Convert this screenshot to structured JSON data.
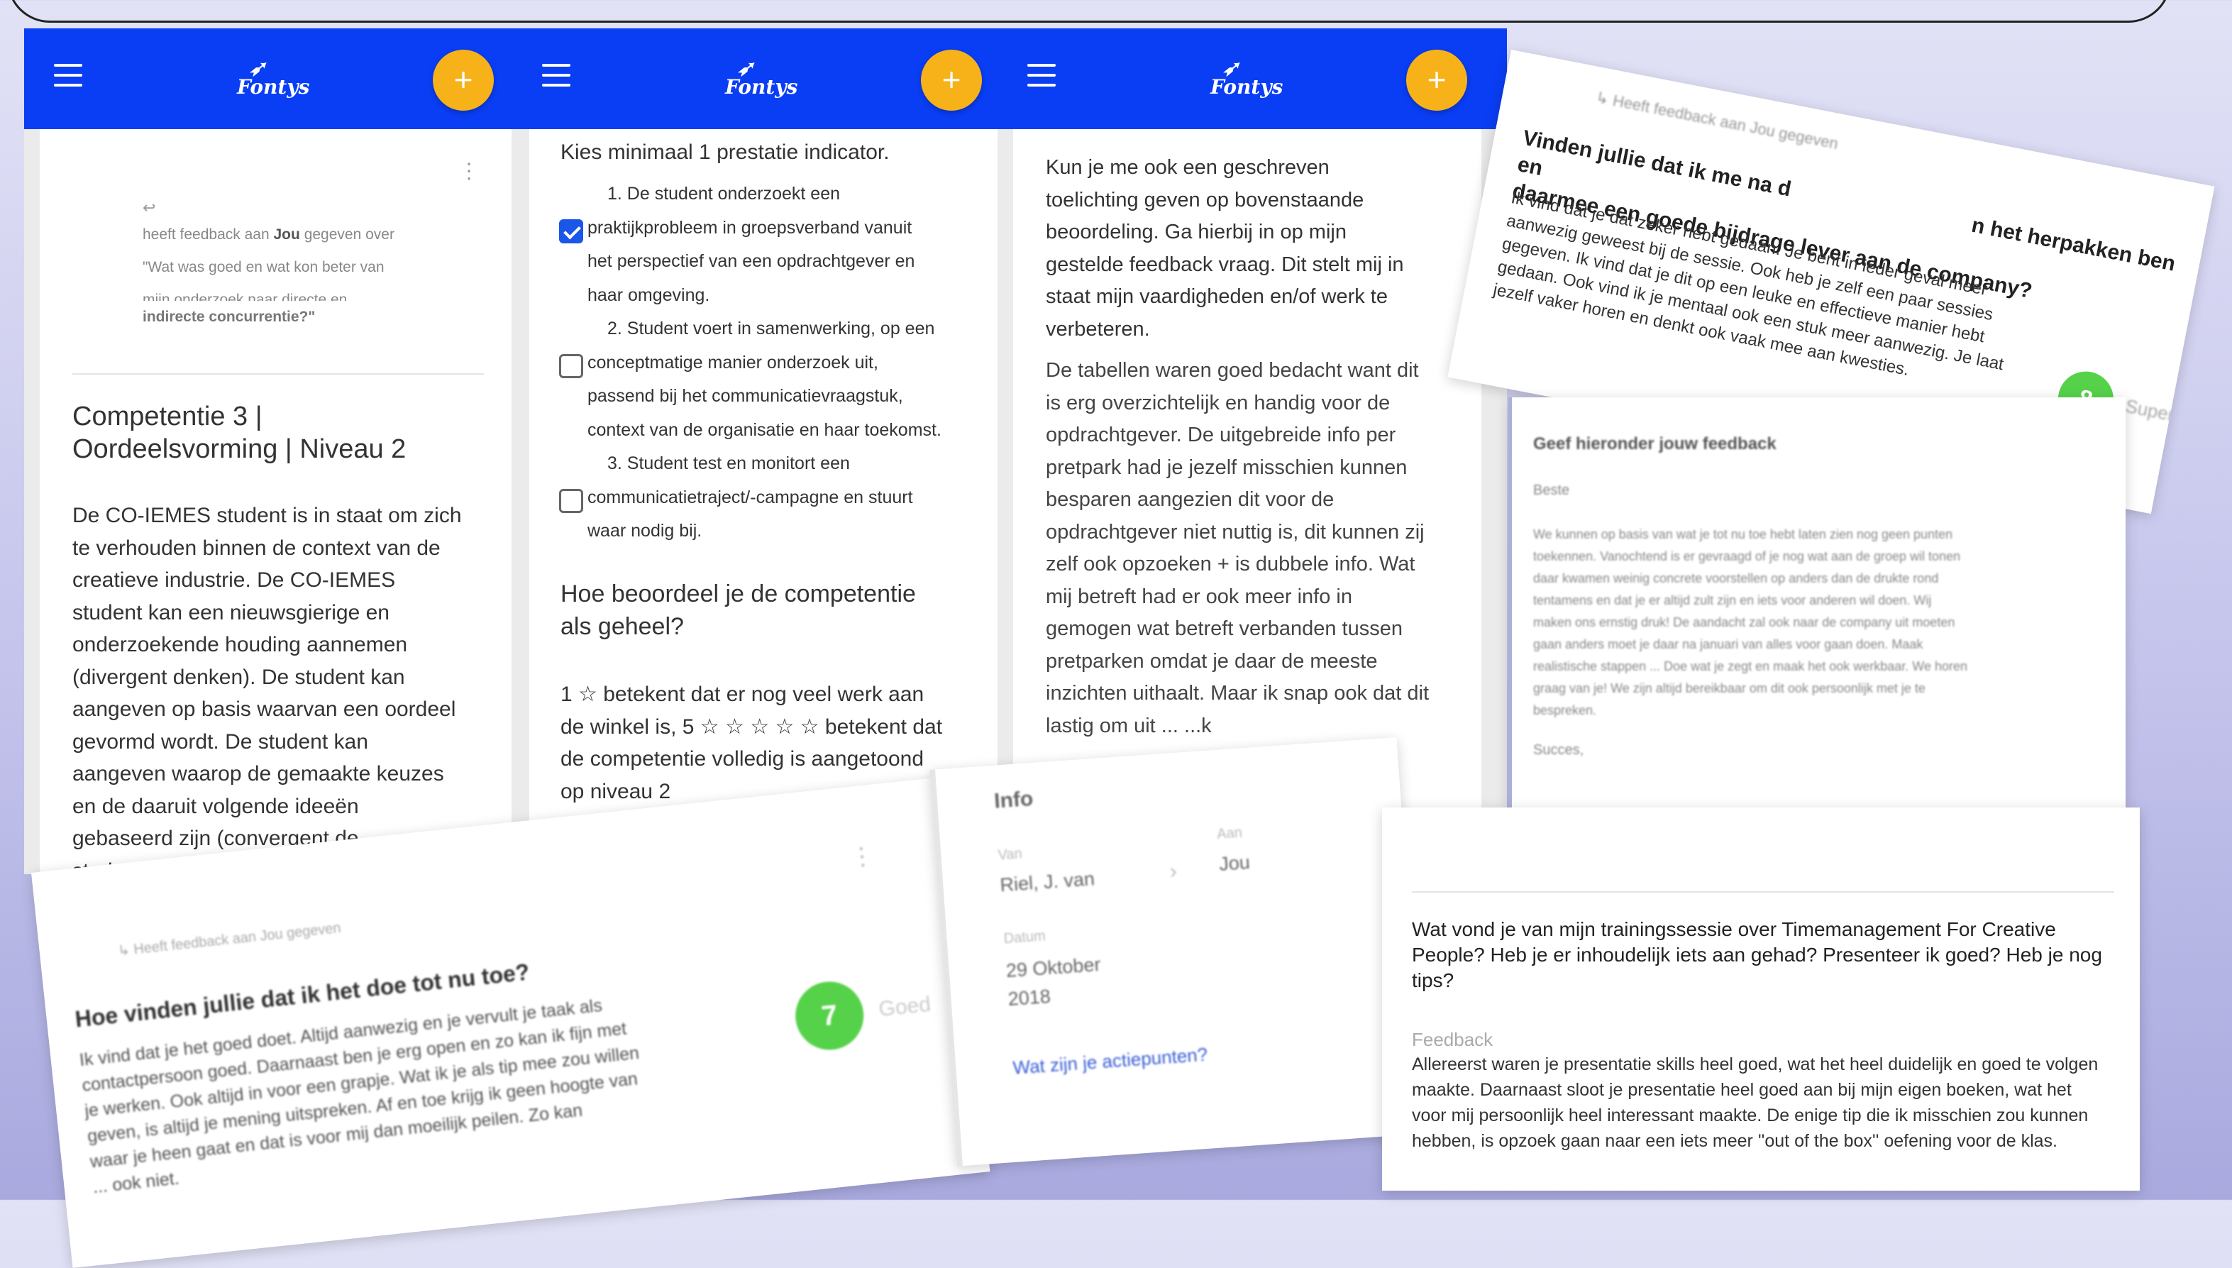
{
  "header": {
    "brand": "Fontys",
    "brand_icon": "bird-logo-icon",
    "fab_label": "+",
    "color": "#0a3ef5",
    "fab_color": "#f7b21a"
  },
  "col1": {
    "feedback_line1": "heeft feedback aan",
    "feedback_you": "Jou",
    "feedback_line1b": "gegeven over",
    "feedback_quote1": "\"Wat was goed en wat kon beter van",
    "feedback_quote2": "mijn onderzoek naar directe en",
    "feedback_quote3": "indirecte concurrentie?\"",
    "heading": "Competentie 3 | Oordeelsvorming | Niveau 2",
    "paragraph": [
      "De CO-IEMES student is in staat om zich",
      "te verhouden binnen de context van de",
      "creatieve industrie. De CO-IEMES",
      "student kan een nieuwsgierige en",
      "onderzoekende houding aannemen",
      "(divergent denken). De student kan",
      "aangeven op basis waarvan een oordeel",
      "gevormd wordt. De student kan",
      "aangeven waarop de gemaakte keuzes",
      "en de daaruit volgende ideeën",
      "gebaseerd zijn (convergent de...",
      "student..."
    ]
  },
  "col2": {
    "instruction": "Kies minimaal 1 prestatie indicator.",
    "indicators": [
      {
        "lines": [
          "1. De student onderzoekt een",
          "praktijkprobleem in groepsverband vanuit",
          "het perspectief van een opdrachtgever en",
          "haar omgeving."
        ],
        "checked": true
      },
      {
        "lines": [
          "2. Student voert in samenwerking, op een",
          "conceptmatige manier onderzoek uit,",
          "passend bij het communicatievraagstuk,",
          "context van de organisatie en haar toekomst."
        ],
        "checked": false
      },
      {
        "lines": [
          "3. Student test en monitort een",
          "communicatietraject/-campagne en stuurt",
          "waar nodig bij."
        ],
        "checked": false
      }
    ],
    "question": [
      "Hoe beoordeel je de competentie",
      "als geheel?"
    ],
    "rating_text": [
      "1 ☆ betekent dat er nog veel werk aan",
      "de winkel is, 5 ☆ ☆ ☆ ☆ ☆ betekent dat",
      "de competentie volledig is aangetoond",
      "op niveau 2"
    ]
  },
  "col3": {
    "question": [
      "Kun je me ook een geschreven",
      "toelichting geven op bovenstaande",
      "beoordeling. Ga hierbij in op mijn",
      "gestelde feedback vraag. Dit stelt mij in",
      "staat mijn vaardigheden en/of werk te",
      "verbeteren."
    ],
    "answer": [
      "De tabellen waren goed bedacht want dit",
      "is erg overzichtelijk en handig voor de",
      "opdrachtgever. De uitgebreide info per",
      "pretpark had je jezelf misschien kunnen",
      "besparen aangezien dit voor de",
      "opdrachtgever niet nuttig is, dit kunnen zij",
      "zelf ook opzoeken + is dubbele info. Wat",
      "mij betreft had er ook meer info in",
      "gemogen wat betreft verbanden tussen",
      "pretparken omdat je daar de meeste",
      "inzichten uithaalt. Maar ik snap ook dat dit",
      "lastig om uit ... ...k"
    ]
  },
  "card_company": {
    "meta": "Heeft feedback aan Jou gegeven",
    "question": "Vinden jullie dat ik me na de ... n het herpakken ben en daarmee een goede bijdrage lever aan de company?",
    "q_line1a": "Vinden jullie dat ik me na d",
    "q_line1b": "n het herpakken ben en",
    "q_line2": "daarmee een goede bijdrage lever aan de company?",
    "answer": [
      "Ik vind dat je dat zeker hebt gedaan. Je bent in ieder geval meer",
      "aanwezig geweest bij de sessie. Ook heb je zelf een paar sessies",
      "gegeven. Ik vind dat je dit op een leuke en effectieve manier hebt",
      "gedaan. Ook vind ik je mentaal ook een stuk meer aanwezig. Je laat",
      "jezelf vaker horen en denkt ook vaak mee aan kwesties."
    ],
    "score": "8",
    "score_label": "Super"
  },
  "card_feedback_form": {
    "heading": "Geef hieronder jouw feedback",
    "salutation": "Beste",
    "body": [
      "We kunnen op basis van wat je tot nu toe hebt laten zien nog geen punten",
      "toekennen. Vanochtend is er gevraagd of je nog wat aan de groep wil tonen",
      "daar kwamen weinig concrete voorstellen op anders dan de drukte rond",
      "tentamens en dat je er altijd zult zijn en iets voor anderen wil doen. Wij",
      "maken ons ernstig druk! De aandacht zal ook naar de company uit moeten",
      "gaan anders moet je daar na januari van alles voor gaan doen. Maak",
      "realistische stappen ... Doe wat je zegt en maak het ook werkbaar. We horen",
      "graag van je! We zijn altijd bereikbaar om dit ook persoonlijk met je te",
      "bespreken."
    ],
    "signoff": "Succes,"
  },
  "card_bottom_left": {
    "meta": "Heeft feedback aan Jou gegeven",
    "question": "Hoe vinden jullie dat ik het doe tot nu toe?",
    "answer": [
      "Ik vind dat je het goed doet. Altijd aanwezig en je vervult je taak als",
      "contactpersoon goed. Daarnaast ben je erg open en zo kan ik fijn met",
      "je werken. Ook altijd in voor een grapje. Wat ik je als tip mee zou willen",
      "geven, is altijd je mening uitspreken. Af en toe krijg ik geen hoogte van",
      "waar je heen gaat en dat is voor mij dan moeilijk peilen. Zo kan",
      "... ook niet."
    ],
    "score": "7",
    "score_label": "Goed"
  },
  "card_info": {
    "title": "Info",
    "van_label": "Van",
    "van_value": "Riel, J. van",
    "aan_label": "Aan",
    "aan_value": "Jou",
    "date_label": "Datum",
    "date_line1": "29 Oktober",
    "date_line2": "2018",
    "action_link": "Wat zijn je actiepunten?"
  },
  "card_training": {
    "question": "Wat vond je van mijn trainingssessie over Timemanagement For Creative People? Heb je er inhoudelijk iets aan gehad? Presenteer ik goed? Heb je nog tips?",
    "feedback_label": "Feedback",
    "feedback": "Allereerst waren je presentatie skills heel goed, wat het heel duidelijk en goed te volgen maakte. Daarnaast sloot je presentatie heel goed aan bij mijn eigen boeken, wat het voor mij persoonlijk heel interessant maakte. De enige tip die ik misschien zou kunnen hebben, is opzoek gaan naar een iets meer ''out of the box'' oefening voor de klas."
  }
}
